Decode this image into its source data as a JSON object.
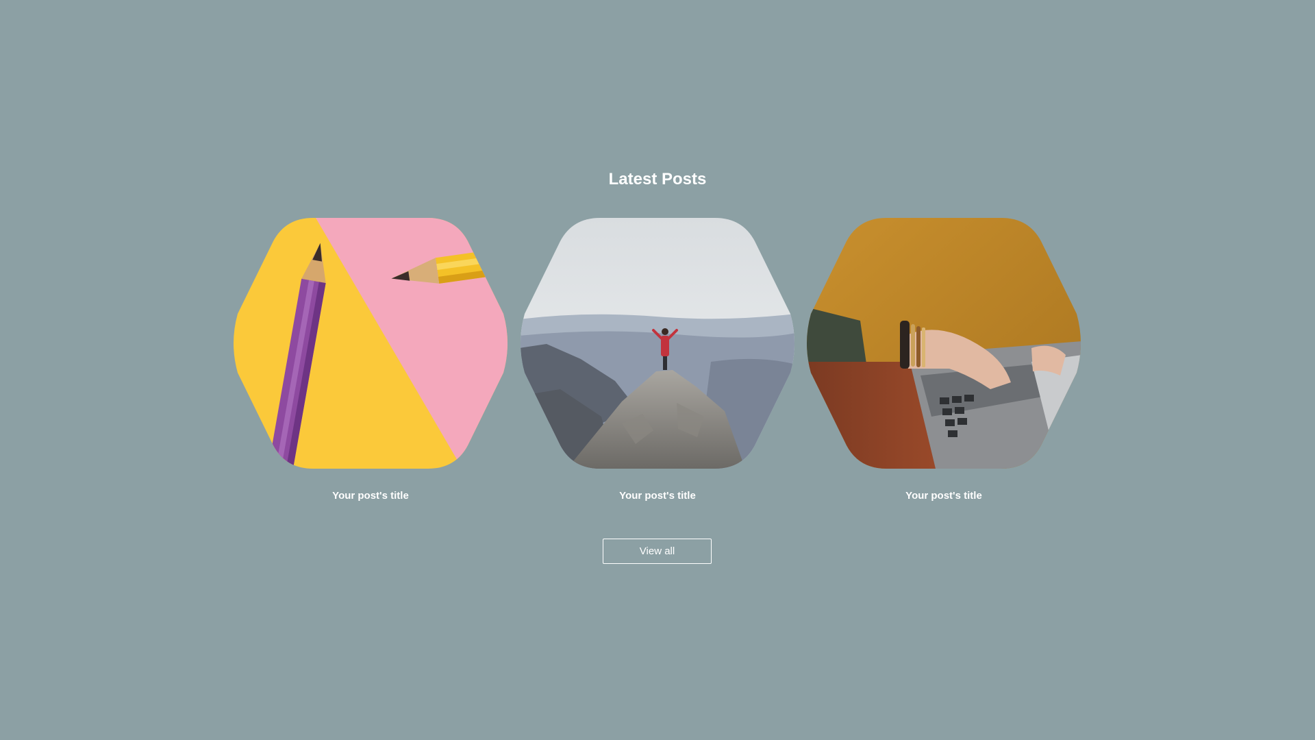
{
  "section": {
    "title": "Latest Posts"
  },
  "posts": [
    {
      "title": "Your post's title",
      "image": "pencils-on-yellow-and-pink-background"
    },
    {
      "title": "Your post's title",
      "image": "person-on-mountain-summit"
    },
    {
      "title": "Your post's title",
      "image": "hands-typing-on-laptop"
    }
  ],
  "actions": {
    "view_all_label": "View all"
  },
  "colors": {
    "background": "#8ca0a4",
    "text": "#ffffff",
    "accent_yellow": "#fbc93a",
    "accent_pink": "#f2a6bb"
  }
}
